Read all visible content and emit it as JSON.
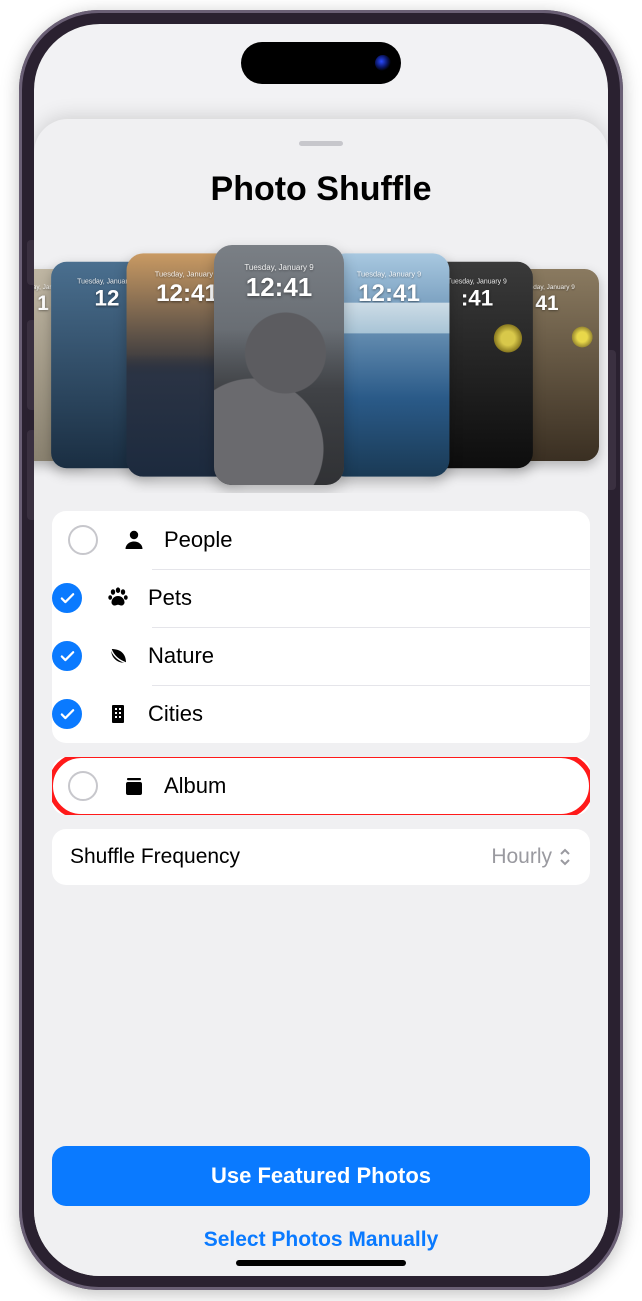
{
  "title": "Photo Shuffle",
  "preview": {
    "date": "Tuesday, January 9",
    "time": "12:41"
  },
  "categories": [
    {
      "key": "people",
      "label": "People",
      "checked": false,
      "icon": "person"
    },
    {
      "key": "pets",
      "label": "Pets",
      "checked": true,
      "icon": "paw"
    },
    {
      "key": "nature",
      "label": "Nature",
      "checked": true,
      "icon": "leaf"
    },
    {
      "key": "cities",
      "label": "Cities",
      "checked": true,
      "icon": "building"
    }
  ],
  "album": {
    "label": "Album",
    "checked": false,
    "highlighted": true
  },
  "shuffle": {
    "label": "Shuffle Frequency",
    "value": "Hourly"
  },
  "buttons": {
    "primary": "Use Featured Photos",
    "secondary": "Select Photos Manually"
  }
}
